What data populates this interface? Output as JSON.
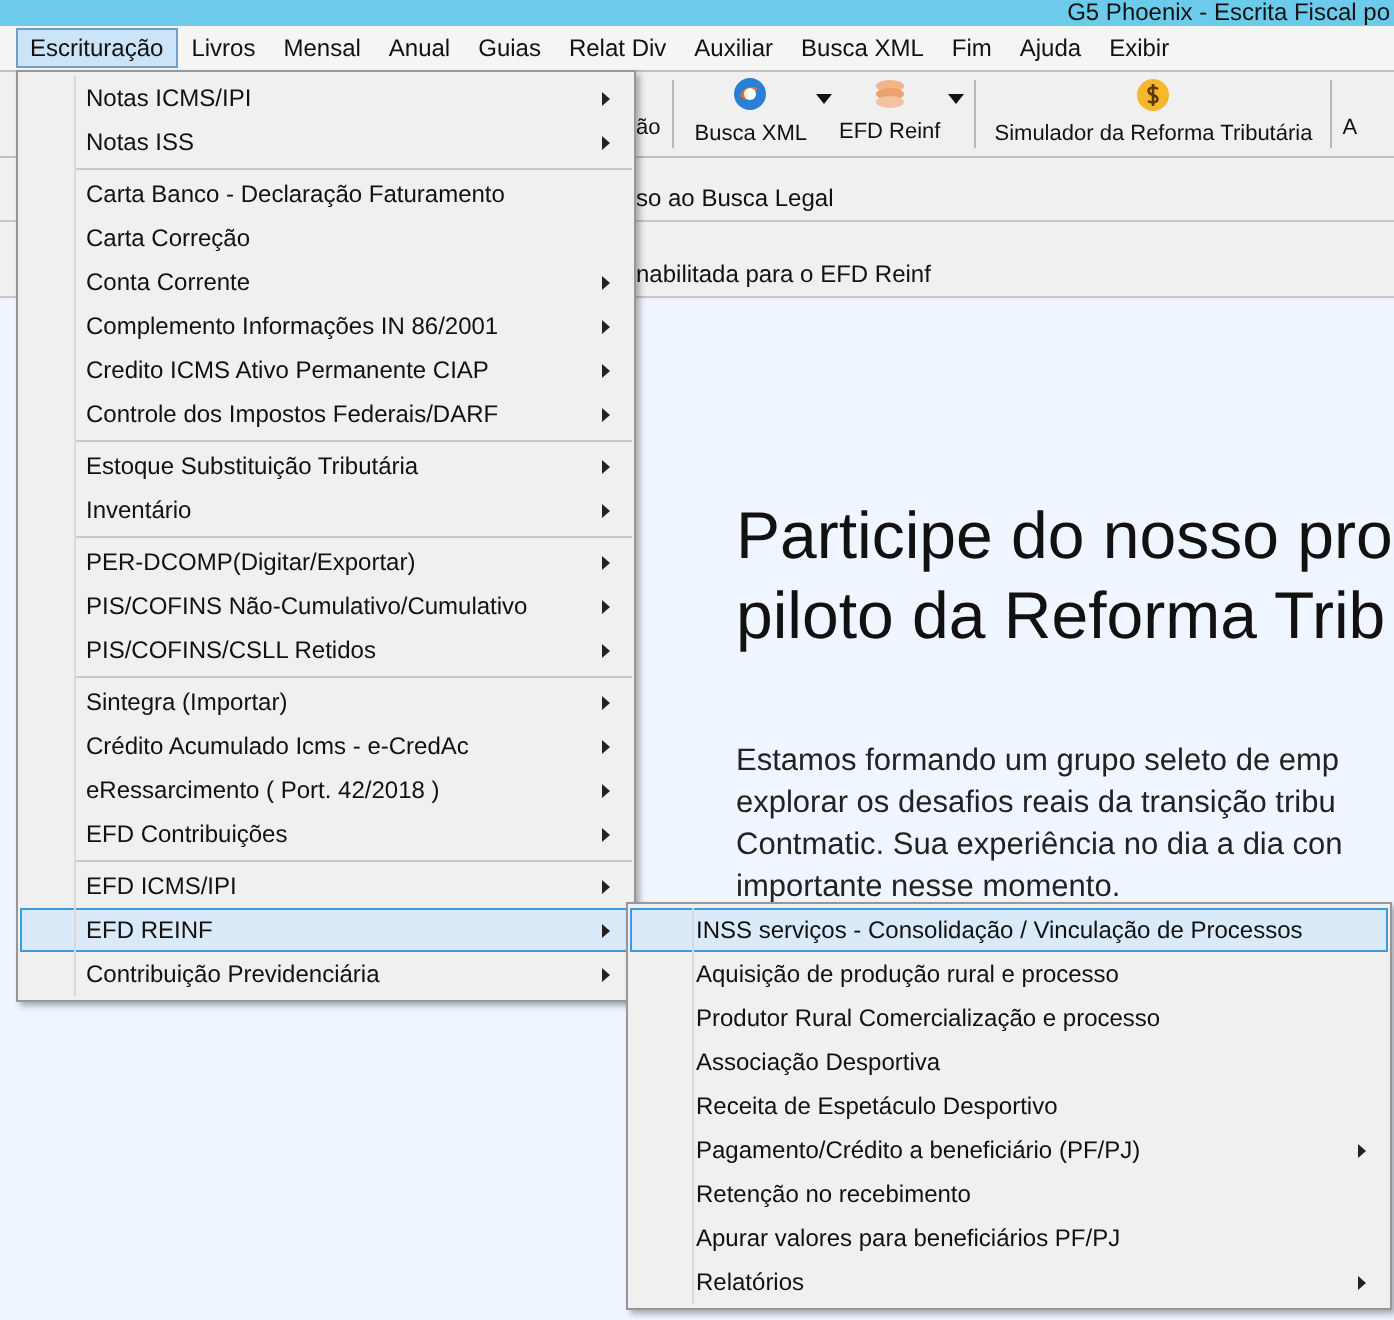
{
  "window": {
    "title": "G5 Phoenix - Escrita Fiscal po"
  },
  "menu_bar": [
    {
      "label": "Escrituração",
      "selected": true
    },
    {
      "label": "Livros",
      "selected": false
    },
    {
      "label": "Mensal",
      "selected": false
    },
    {
      "label": "Anual",
      "selected": false
    },
    {
      "label": "Guias",
      "selected": false
    },
    {
      "label": "Relat Div",
      "selected": false
    },
    {
      "label": "Auxiliar",
      "selected": false
    },
    {
      "label": "Busca XML",
      "selected": false
    },
    {
      "label": "Fim",
      "selected": false
    },
    {
      "label": "Ajuda",
      "selected": false
    },
    {
      "label": "Exibir",
      "selected": false
    }
  ],
  "toolbar": [
    {
      "kind": "text",
      "label": "ão"
    },
    {
      "kind": "xml",
      "label": "Busca XML",
      "dropdown": true
    },
    {
      "kind": "reinf",
      "label": "EFD Reinf",
      "dropdown": true
    },
    {
      "kind": "money",
      "label": "Simulador da Reforma Tributária",
      "dropdown": false
    },
    {
      "kind": "text",
      "label": "A"
    }
  ],
  "info_rows": [
    {
      "text": "so ao Busca Legal"
    },
    {
      "text": "nabilitada para o EFD Reinf"
    }
  ],
  "banner": {
    "heading": [
      "Participe do nosso pro",
      "piloto da Reforma Trib"
    ],
    "body": [
      "Estamos formando um grupo seleto de emp",
      "explorar os desafios reais da transição tribu",
      "Contmatic. Sua experiência no dia a dia con",
      "importante nesse momento."
    ]
  },
  "menu": [
    {
      "kind": "item",
      "label": "Notas ICMS/IPI",
      "submenu": true,
      "selected": false
    },
    {
      "kind": "item",
      "label": "Notas ISS",
      "submenu": true,
      "selected": false
    },
    {
      "kind": "separator"
    },
    {
      "kind": "item",
      "label": "Carta Banco - Declaração Faturamento",
      "submenu": false,
      "selected": false
    },
    {
      "kind": "item",
      "label": "Carta Correção",
      "submenu": false,
      "selected": false
    },
    {
      "kind": "item",
      "label": "Conta Corrente",
      "submenu": true,
      "selected": false
    },
    {
      "kind": "item",
      "label": "Complemento Informações IN 86/2001",
      "submenu": true,
      "selected": false
    },
    {
      "kind": "item",
      "label": "Credito ICMS Ativo Permanente CIAP",
      "submenu": true,
      "selected": false
    },
    {
      "kind": "item",
      "label": "Controle dos Impostos Federais/DARF",
      "submenu": true,
      "selected": false
    },
    {
      "kind": "separator"
    },
    {
      "kind": "item",
      "label": "Estoque Substituição Tributária",
      "submenu": true,
      "selected": false
    },
    {
      "kind": "item",
      "label": "Inventário",
      "submenu": true,
      "selected": false
    },
    {
      "kind": "separator"
    },
    {
      "kind": "item",
      "label": "PER-DCOMP(Digitar/Exportar)",
      "submenu": true,
      "selected": false
    },
    {
      "kind": "item",
      "label": "PIS/COFINS Não-Cumulativo/Cumulativo",
      "submenu": true,
      "selected": false
    },
    {
      "kind": "item",
      "label": "PIS/COFINS/CSLL Retidos",
      "submenu": true,
      "selected": false
    },
    {
      "kind": "separator"
    },
    {
      "kind": "item",
      "label": "Sintegra (Importar)",
      "submenu": true,
      "selected": false
    },
    {
      "kind": "item",
      "label": "Crédito Acumulado Icms - e-CredAc",
      "submenu": true,
      "selected": false
    },
    {
      "kind": "item",
      "label": "eRessarcimento ( Port. 42/2018 )",
      "submenu": true,
      "selected": false
    },
    {
      "kind": "item",
      "label": "EFD Contribuições",
      "submenu": true,
      "selected": false
    },
    {
      "kind": "separator"
    },
    {
      "kind": "item",
      "label": "EFD ICMS/IPI",
      "submenu": true,
      "selected": false
    },
    {
      "kind": "item",
      "label": "EFD REINF",
      "submenu": true,
      "selected": true
    },
    {
      "kind": "item",
      "label": "Contribuição Previdenciária",
      "submenu": true,
      "selected": false
    }
  ],
  "submenu": [
    {
      "kind": "item",
      "label": "INSS serviços - Consolidação / Vinculação de Processos",
      "submenu": false,
      "selected": true
    },
    {
      "kind": "item",
      "label": "Aquisição de produção rural e processo",
      "submenu": false,
      "selected": false
    },
    {
      "kind": "item",
      "label": "Produtor Rural Comercialização e processo",
      "submenu": false,
      "selected": false
    },
    {
      "kind": "item",
      "label": "Associação Desportiva",
      "submenu": false,
      "selected": false
    },
    {
      "kind": "item",
      "label": "Receita de Espetáculo Desportivo",
      "submenu": false,
      "selected": false
    },
    {
      "kind": "item",
      "label": "Pagamento/Crédito a beneficiário (PF/PJ)",
      "submenu": true,
      "selected": false
    },
    {
      "kind": "item",
      "label": "Retenção no recebimento",
      "submenu": false,
      "selected": false
    },
    {
      "kind": "item",
      "label": "Apurar valores para beneficiários PF/PJ",
      "submenu": false,
      "selected": false
    },
    {
      "kind": "item",
      "label": "Relatórios",
      "submenu": true,
      "selected": false
    }
  ]
}
